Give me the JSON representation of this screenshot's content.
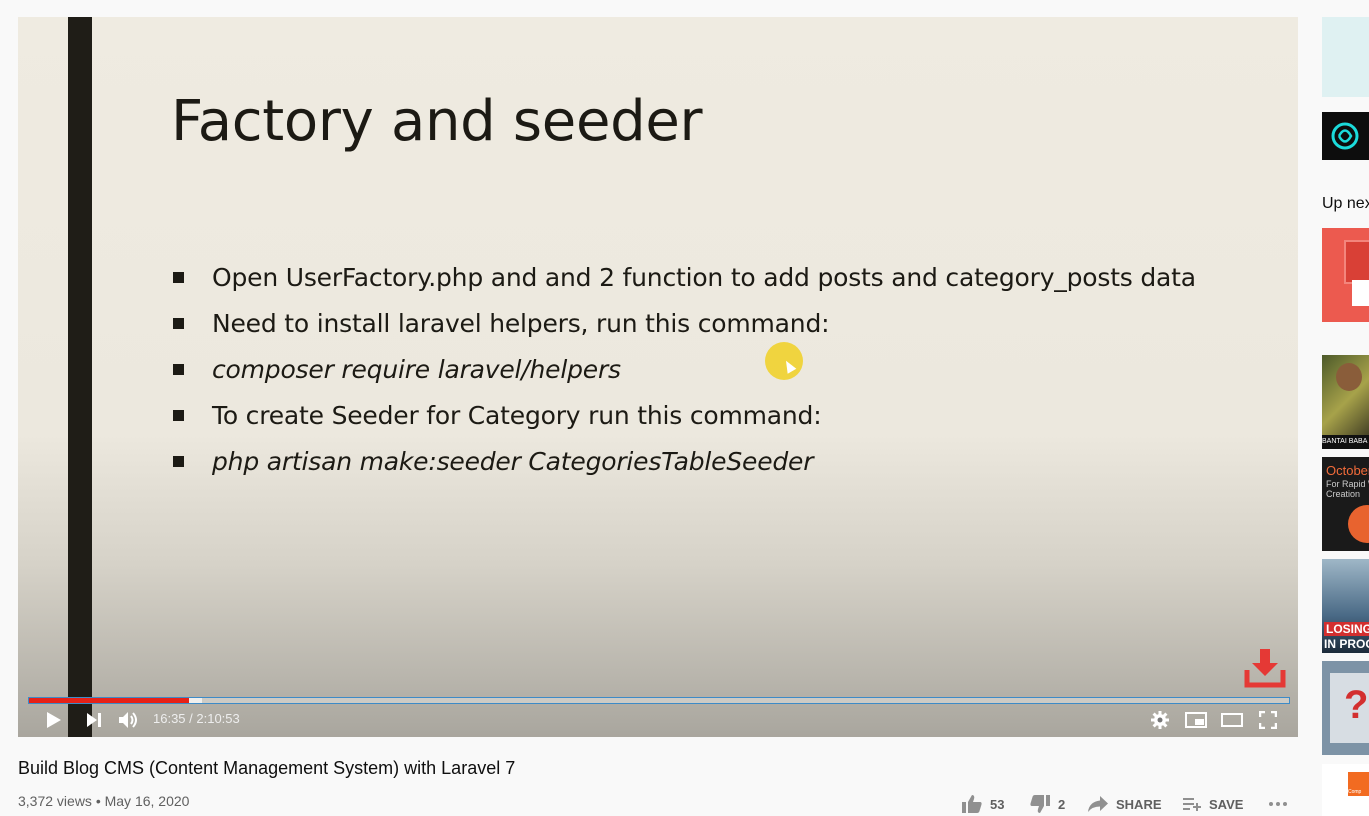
{
  "slide": {
    "title": "Factory and seeder",
    "bullets": [
      {
        "text": "Open UserFactory.php and and 2 function to add posts and category_posts data",
        "italic": false
      },
      {
        "text": "Need to install laravel helpers, run this command:",
        "italic": false
      },
      {
        "text": "composer require laravel/helpers",
        "italic": true
      },
      {
        "text": "To create Seeder for Category run this command:",
        "italic": false
      },
      {
        "text": "php artisan make:seeder CategoriesTableSeeder",
        "italic": true
      }
    ]
  },
  "player": {
    "time": "16:35 / 2:10:53",
    "progress_played_fraction": 0.127,
    "progress_buffered_fraction": 0.137,
    "colors": {
      "progress": "#e62117",
      "download_icon": "#e53935"
    },
    "icons": [
      "play-icon",
      "next-icon",
      "volume-icon",
      "settings-icon",
      "miniplayer-icon",
      "theater-icon",
      "fullscreen-icon",
      "download-icon"
    ]
  },
  "video": {
    "title": "Build Blog CMS (Content Management System) with Laravel 7",
    "views": "3,372 views",
    "date": "May 16, 2020",
    "meta": "3,372 views • May 16, 2020"
  },
  "actions": {
    "likes": "53",
    "dislikes": "2",
    "share": "SHARE",
    "save": "SAVE"
  },
  "sidebar": {
    "up_next": "Up nex",
    "thumb_texts": {
      "gamer": "BANTAI BABA G",
      "october_title": "October",
      "october_sub1": "For Rapid W",
      "october_sub2": "Creation",
      "losing1": "LOSING",
      "losing2": "IN PROG",
      "small": "Comp"
    }
  }
}
